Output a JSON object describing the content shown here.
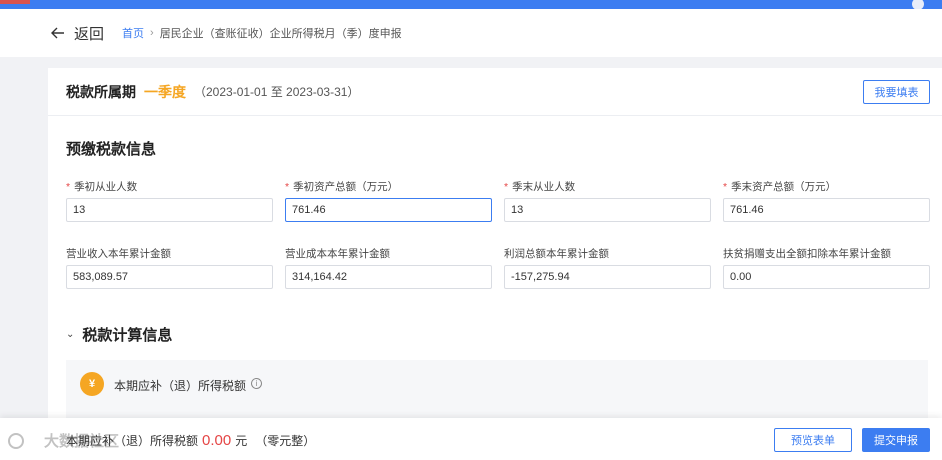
{
  "header": {
    "back_label": "返回",
    "breadcrumb_home": "首页",
    "breadcrumb_current": "居民企业（查账征收）企业所得税月（季）度申报"
  },
  "period": {
    "label": "税款所属期",
    "quarter": "一季度",
    "range": "（2023-01-01 至 2023-03-31）",
    "fill_button": "我要填表"
  },
  "prepaid": {
    "title": "预缴税款信息",
    "fields": [
      {
        "label": "季初从业人数",
        "value": "13",
        "required": "*"
      },
      {
        "label": "季初资产总额（万元）",
        "value": "761.46",
        "required": "*"
      },
      {
        "label": "季末从业人数",
        "value": "13",
        "required": "*"
      },
      {
        "label": "季末资产总额（万元）",
        "value": "761.46",
        "required": "*"
      },
      {
        "label": "营业收入本年累计金额",
        "value": "583,089.57"
      },
      {
        "label": "营业成本本年累计金额",
        "value": "314,164.42"
      },
      {
        "label": "利润总额本年累计金额",
        "value": "-157,275.94"
      },
      {
        "label": "扶贫捐赠支出全额扣除本年累计金额",
        "value": "0.00"
      }
    ]
  },
  "calc": {
    "title": "税款计算信息",
    "panel_label": "本期应补（退）所得税额",
    "coin_symbol": "¥",
    "info_symbol": "i"
  },
  "footer": {
    "watermark": "大数据社区",
    "label": "本期应补（退）所得税额",
    "amount": "0.00",
    "unit": "元",
    "amount_words": "（零元整）",
    "preview_button": "预览表单",
    "submit_button": "提交申报"
  }
}
